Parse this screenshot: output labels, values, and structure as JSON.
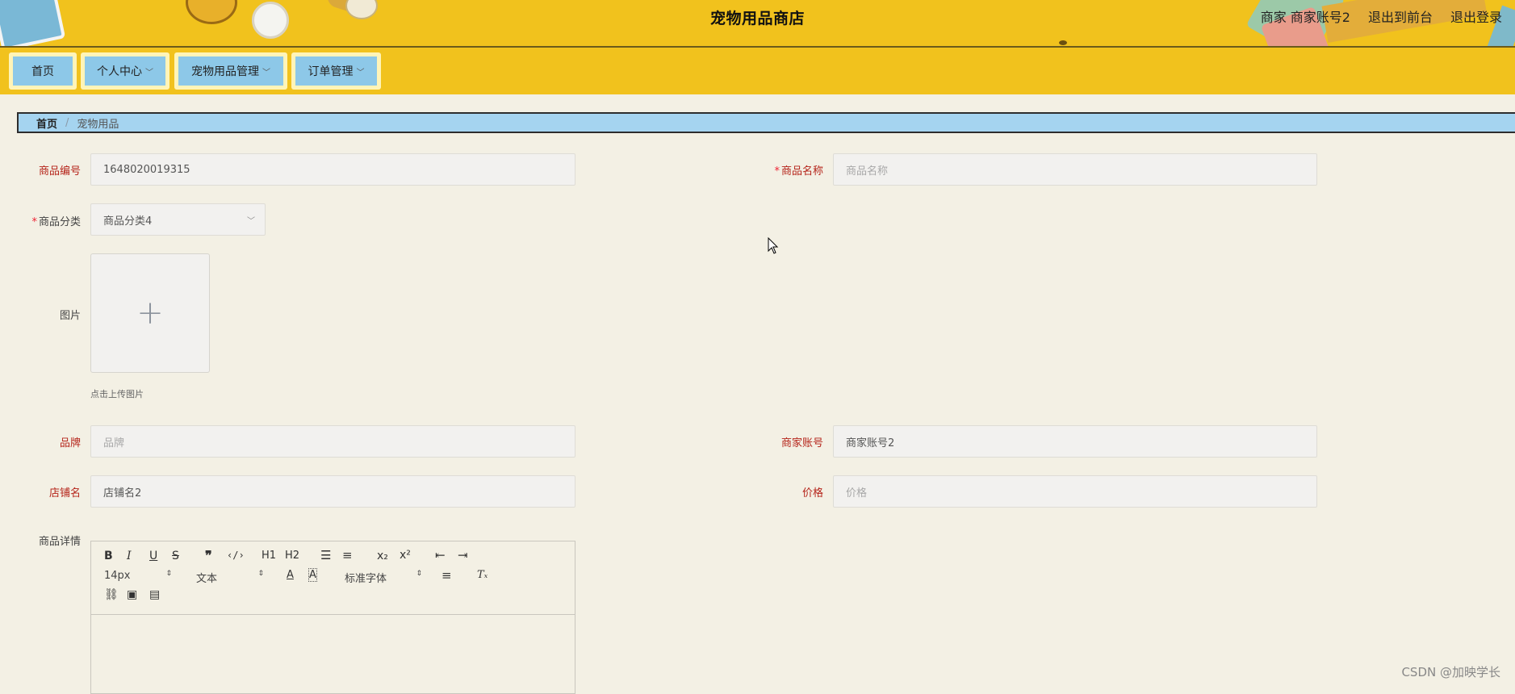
{
  "header": {
    "title": "宠物用品商店",
    "user_info": "商家 商家账号2",
    "back_to_front": "退出到前台",
    "logout": "退出登录"
  },
  "nav": {
    "items": [
      {
        "label": "首页"
      },
      {
        "label": "个人中心"
      },
      {
        "label": "宠物用品管理"
      },
      {
        "label": "订单管理"
      }
    ]
  },
  "breadcrumb": {
    "home": "首页",
    "separator": "/",
    "current": "宠物用品"
  },
  "form": {
    "product_code": {
      "label": "商品编号",
      "value": "1648020019315"
    },
    "product_name": {
      "label": "商品名称",
      "placeholder": "商品名称"
    },
    "category": {
      "label": "商品分类",
      "value": "商品分类4"
    },
    "image": {
      "label": "图片",
      "tip": "点击上传图片"
    },
    "brand": {
      "label": "品牌",
      "placeholder": "品牌"
    },
    "merchant_account": {
      "label": "商家账号",
      "value": "商家账号2"
    },
    "shop_name": {
      "label": "店铺名",
      "value": "店铺名2"
    },
    "price": {
      "label": "价格",
      "placeholder": "价格"
    },
    "details": {
      "label": "商品详情"
    }
  },
  "editor": {
    "font_size": "14px",
    "text_type": "文本",
    "font_family": "标准字体",
    "bold": "B",
    "italic": "I",
    "underline": "U",
    "strike": "S",
    "h1": "H1",
    "h2": "H2",
    "sub": "x₂",
    "sup": "x²"
  },
  "watermark": "CSDN @加映学长",
  "colors": {
    "header_bg": "#f1c21d",
    "nav_button": "#8dc8e8",
    "page_bg": "#f3f0e4",
    "label_red": "#b5241a"
  }
}
